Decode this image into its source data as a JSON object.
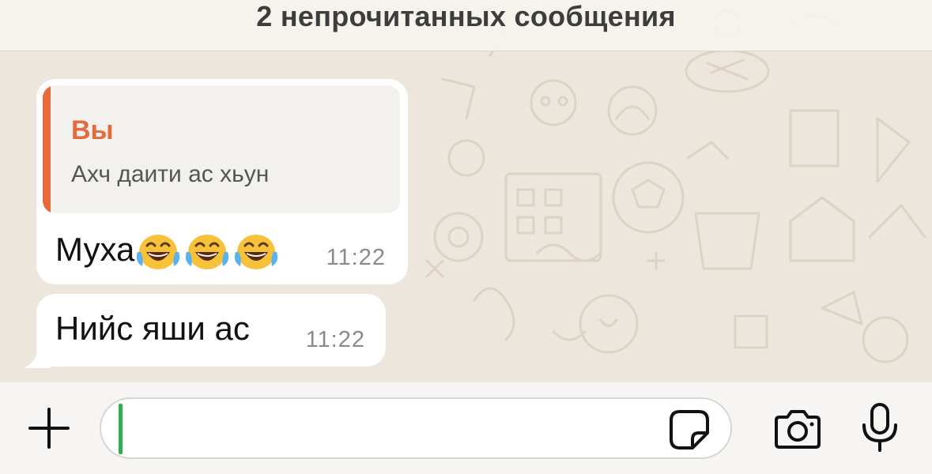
{
  "chat": {
    "unread_banner": "2 непрочитанных сообщения",
    "messages": [
      {
        "quote_author": "Вы",
        "quote_text": "Ахч даити ас хьун",
        "text": "Муха",
        "emojis": [
          "face-with-tears-of-joy",
          "face-with-tears-of-joy",
          "face-with-tears-of-joy"
        ],
        "time": "11:22"
      },
      {
        "text": "Нийс яши ас",
        "time": "11:22"
      }
    ]
  },
  "composer": {
    "placeholder": "",
    "icons": {
      "attach": "plus-icon",
      "sticker": "sticker-icon",
      "camera": "camera-icon",
      "mic": "microphone-icon"
    }
  },
  "colors": {
    "quote_accent": "#e56b3f",
    "cursor": "#2fb04f",
    "chat_background": "#ede6dc"
  }
}
